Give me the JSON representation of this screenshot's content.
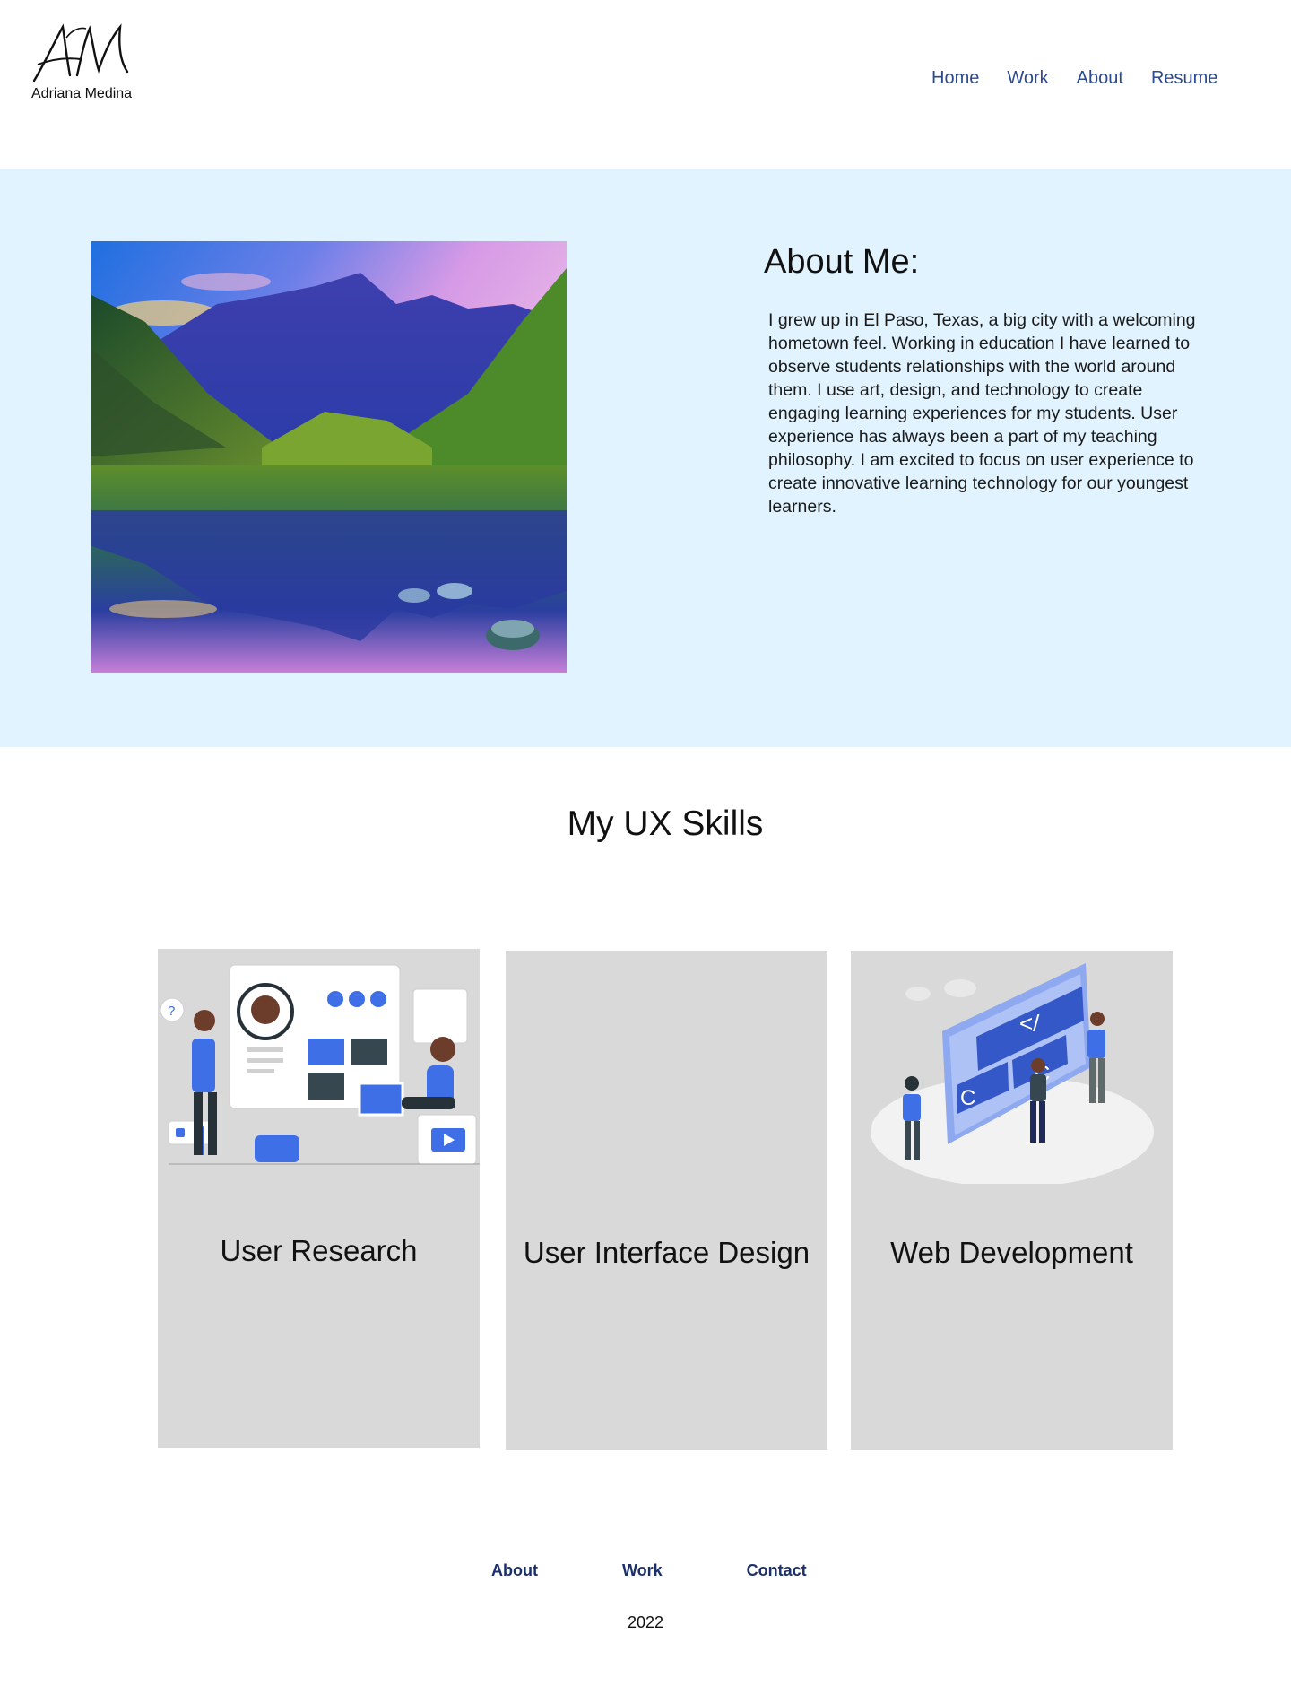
{
  "header": {
    "logo_text": "AM",
    "logo_name": "Adriana Medina",
    "nav": [
      {
        "label": "Home"
      },
      {
        "label": "Work"
      },
      {
        "label": "About"
      },
      {
        "label": "Resume"
      }
    ]
  },
  "about": {
    "title": "About Me:",
    "body": "I grew up in El Paso, Texas, a big city with a welcoming hometown feel. Working in education I have learned to observe students relationships with the world around them. I use art, design, and technology to create engaging learning experiences for my students.  User experience has always been a part of my teaching philosophy. I am excited to focus on user experience to create innovative learning technology for our youngest learners.",
    "image_icon": "mountain-lake-photo"
  },
  "skills": {
    "title": "My UX Skills",
    "cards": [
      {
        "label": "User Research",
        "icon": "user-research-illustration"
      },
      {
        "label": "User Interface Design",
        "icon": "none"
      },
      {
        "label": "Web Development",
        "icon": "web-development-illustration"
      }
    ]
  },
  "footer": {
    "links": [
      {
        "label": "About"
      },
      {
        "label": "Work"
      },
      {
        "label": "Contact"
      }
    ],
    "year": "2022"
  },
  "colors": {
    "nav_link": "#2c4a8f",
    "about_bg": "#e1f3fe",
    "card_bg": "#d9d9d9",
    "footer_link": "#1a2f6b",
    "accent_blue": "#3f6fe6"
  }
}
